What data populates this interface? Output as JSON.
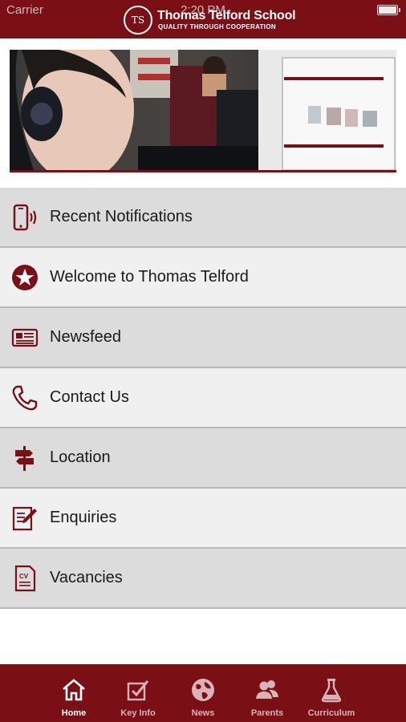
{
  "status_bar": {
    "carrier": "Carrier",
    "time": "2:20 PM"
  },
  "header": {
    "logo_text": "TS",
    "title": "Thomas Telford School",
    "motto": "QUALITY THROUGH COOPERATION"
  },
  "banner": {
    "alt": "students-at-computers-photo"
  },
  "menu": {
    "items": [
      {
        "label": "Recent Notifications",
        "icon": "phone-notification-icon"
      },
      {
        "label": "Welcome to Thomas Telford",
        "icon": "star-badge-icon"
      },
      {
        "label": "Newsfeed",
        "icon": "newspaper-icon"
      },
      {
        "label": "Contact Us",
        "icon": "phone-handset-icon"
      },
      {
        "label": "Location",
        "icon": "signpost-icon"
      },
      {
        "label": "Enquiries",
        "icon": "edit-document-icon"
      },
      {
        "label": "Vacancies",
        "icon": "cv-document-icon"
      }
    ]
  },
  "tabbar": {
    "tabs": [
      {
        "label": "Home",
        "icon": "home-icon",
        "active": true
      },
      {
        "label": "Key Info",
        "icon": "checkbox-icon",
        "active": false
      },
      {
        "label": "News",
        "icon": "globe-icon",
        "active": false
      },
      {
        "label": "Parents",
        "icon": "people-icon",
        "active": false
      },
      {
        "label": "Curriculum",
        "icon": "flask-icon",
        "active": false
      }
    ]
  },
  "colors": {
    "brand": "#7a1016",
    "row_dark": "#dcdcdc",
    "row_light": "#f0f0f0"
  }
}
